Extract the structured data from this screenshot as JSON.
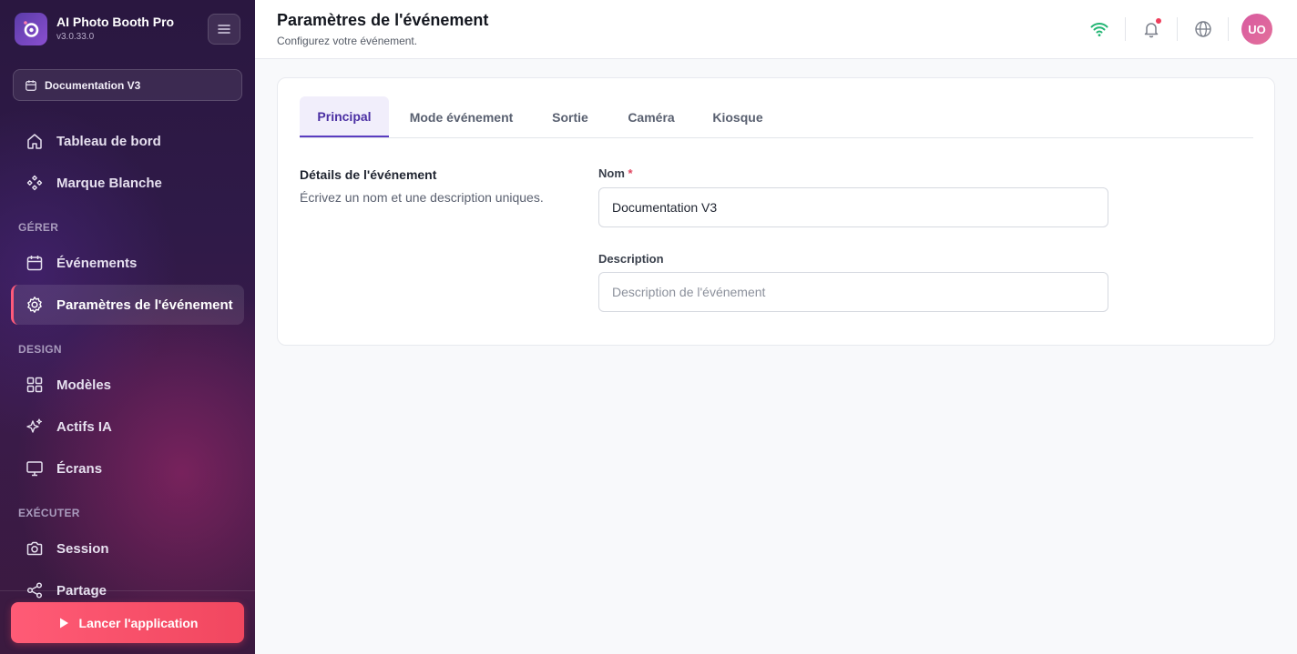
{
  "app": {
    "name": "AI Photo Booth Pro",
    "version": "v3.0.33.0"
  },
  "sidebar": {
    "event_selector": "Documentation V3",
    "items": [
      {
        "label": "Tableau de bord",
        "icon": "home-icon"
      },
      {
        "label": "Marque Blanche",
        "icon": "brand-icon"
      }
    ],
    "sections": [
      {
        "title": "GÉRER",
        "items": [
          {
            "label": "Événements",
            "icon": "calendar-icon"
          },
          {
            "label": "Paramètres de l'événement",
            "icon": "gear-icon",
            "active": true
          }
        ]
      },
      {
        "title": "DESIGN",
        "items": [
          {
            "label": "Modèles",
            "icon": "grid-icon"
          },
          {
            "label": "Actifs IA",
            "icon": "sparkles-icon"
          },
          {
            "label": "Écrans",
            "icon": "monitor-icon"
          }
        ]
      },
      {
        "title": "EXÉCUTER",
        "items": [
          {
            "label": "Session",
            "icon": "camera-icon"
          },
          {
            "label": "Partage",
            "icon": "share-icon"
          }
        ]
      }
    ],
    "launch_label": "Lancer l'application"
  },
  "header": {
    "title": "Paramètres de l'événement",
    "subtitle": "Configurez votre événement.",
    "avatar_initials": "UO"
  },
  "tabs": [
    {
      "label": "Principal",
      "active": true
    },
    {
      "label": "Mode événement"
    },
    {
      "label": "Sortie"
    },
    {
      "label": "Caméra"
    },
    {
      "label": "Kiosque"
    }
  ],
  "details": {
    "title": "Détails de l'événement",
    "description": "Écrivez un nom et une description uniques."
  },
  "form": {
    "name_label": "Nom",
    "name_required_mark": "*",
    "name_value": "Documentation V3",
    "description_label": "Description",
    "description_placeholder": "Description de l'événement"
  },
  "colors": {
    "accent": "#5a3cc0",
    "launch_button": "#f1475f",
    "wifi_connected": "#22b573",
    "notification_dot": "#ef3e5c",
    "avatar": "#d85aa0"
  }
}
